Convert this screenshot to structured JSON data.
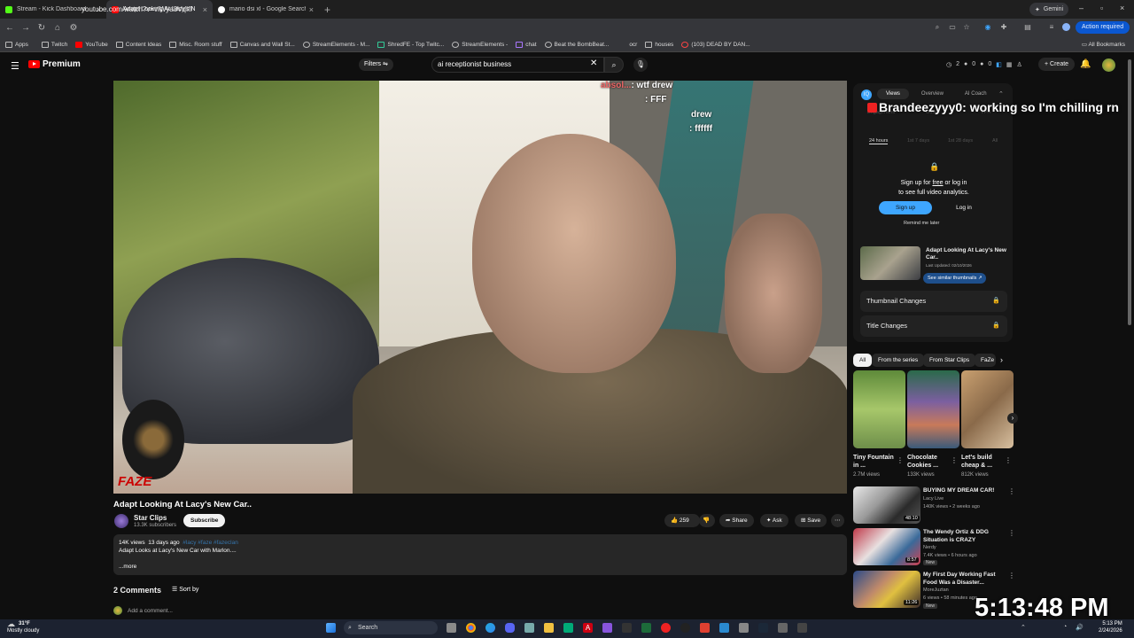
{
  "browser": {
    "tabs": [
      {
        "title": "Stream - Kick Dashboard",
        "color": "#53fc18"
      },
      {
        "title": "Adapt Looking At Lacy's N",
        "color": "#ff0000"
      },
      {
        "title": "mario dsi xl - Google Search",
        "color": "#ffffff"
      }
    ],
    "gemini": "Gemini",
    "url": "youtube.com/watch?v=vlWya8VqIfI",
    "action_required": "Action required",
    "bookmarks": [
      "Apps",
      "Twitch",
      "YouTube",
      "Content Ideas",
      "Misc. Room stuff",
      "Canvas and Wall St...",
      "StreamElements - M...",
      "ShredFE - Top Twitc...",
      "StreamElements -",
      "chat",
      "Beat the BombBeat...",
      "ocr",
      "houses",
      "(103) DEAD BY DAN..."
    ],
    "all_bookmarks": "All Bookmarks"
  },
  "yt_header": {
    "logo": "Premium",
    "filters": "Filters",
    "search_value": "ai receptionist business",
    "stats": [
      "2",
      "0",
      "0"
    ],
    "create": "Create"
  },
  "video": {
    "chat_lines": [
      {
        "user": "absol...",
        "msg": ": wtf drew"
      },
      {
        "user": "",
        "msg": ": FFF"
      },
      {
        "user": "",
        "msg": "drew"
      },
      {
        "user": "",
        "msg": ": ffffff"
      }
    ],
    "watermark": "FAZE",
    "title": "Adapt Looking At Lacy's New Car..",
    "channel": "Star Clips",
    "subscribers": "13.3K subscribers",
    "subscribe": "Subscribe",
    "likes": "259",
    "share": "Share",
    "ask": "Ask",
    "save": "Save",
    "views": "14K views",
    "age": "13 days ago",
    "tags": "#lacy #faze #fazeclan",
    "description": "Adapt Looks at Lacy's New Car with Marlon....",
    "more": "...more",
    "comments": "2 Comments",
    "sort_by": "Sort by",
    "add_comment": "Add a comment..."
  },
  "analytics": {
    "tabs": [
      "Views",
      "Overview",
      "AI Coach"
    ],
    "faint_labels": [
      "Engagement",
      "Outlier",
      "VPH",
      "24 hours",
      "1st 7 days",
      "1st 28 days",
      "All"
    ],
    "overlay_chat": "Brandeezyyy0: working so I'm chilling rn",
    "signup_text_a": "Sign up for",
    "signup_text_free": "free",
    "signup_text_b": "or log in",
    "signup_text_c": "to see full video analytics.",
    "signup": "Sign up",
    "login": "Log in",
    "remind": "Remind me later",
    "video_title": "Adapt Looking At Lacy's New Car..",
    "last_updated": "Last Updated: 02/10/2026",
    "see_similar": "See similar thumbnails",
    "rows": [
      "Thumbnail Changes",
      "Title Changes"
    ]
  },
  "recs": {
    "chips": [
      "All",
      "From the series",
      "From Star Clips",
      "FaZe"
    ],
    "shorts": [
      {
        "title": "Tiny Fountain in ...",
        "views": "2.7M views"
      },
      {
        "title": "Chocolate Cookies ...",
        "views": "133K views"
      },
      {
        "title": "Let's build cheap & ...",
        "views": "812K views"
      }
    ],
    "videos": [
      {
        "title": "BUYING MY DREAM CAR!",
        "channel": "Lacy Live",
        "meta": "140K views • 2 weeks ago",
        "duration": "48:10",
        "new": ""
      },
      {
        "title": "The Wendy Ortiz & DDG Situation is CRAZY",
        "channel": "Nerdy",
        "meta": "7.4K views • 6 hours ago",
        "duration": "8:57",
        "new": "New"
      },
      {
        "title": "My First Day Working Fast Food Was a Disaster...",
        "channel": "MoreJuztan",
        "meta": "6 views • 58 minutes ago",
        "duration": "11:26",
        "new": "New"
      }
    ]
  },
  "stream_clock": "5:13:48 PM",
  "taskbar": {
    "temp": "31°F",
    "weather": "Mostly cloudy",
    "search": "Search",
    "time": "5:13 PM",
    "date": "2/24/2026"
  }
}
